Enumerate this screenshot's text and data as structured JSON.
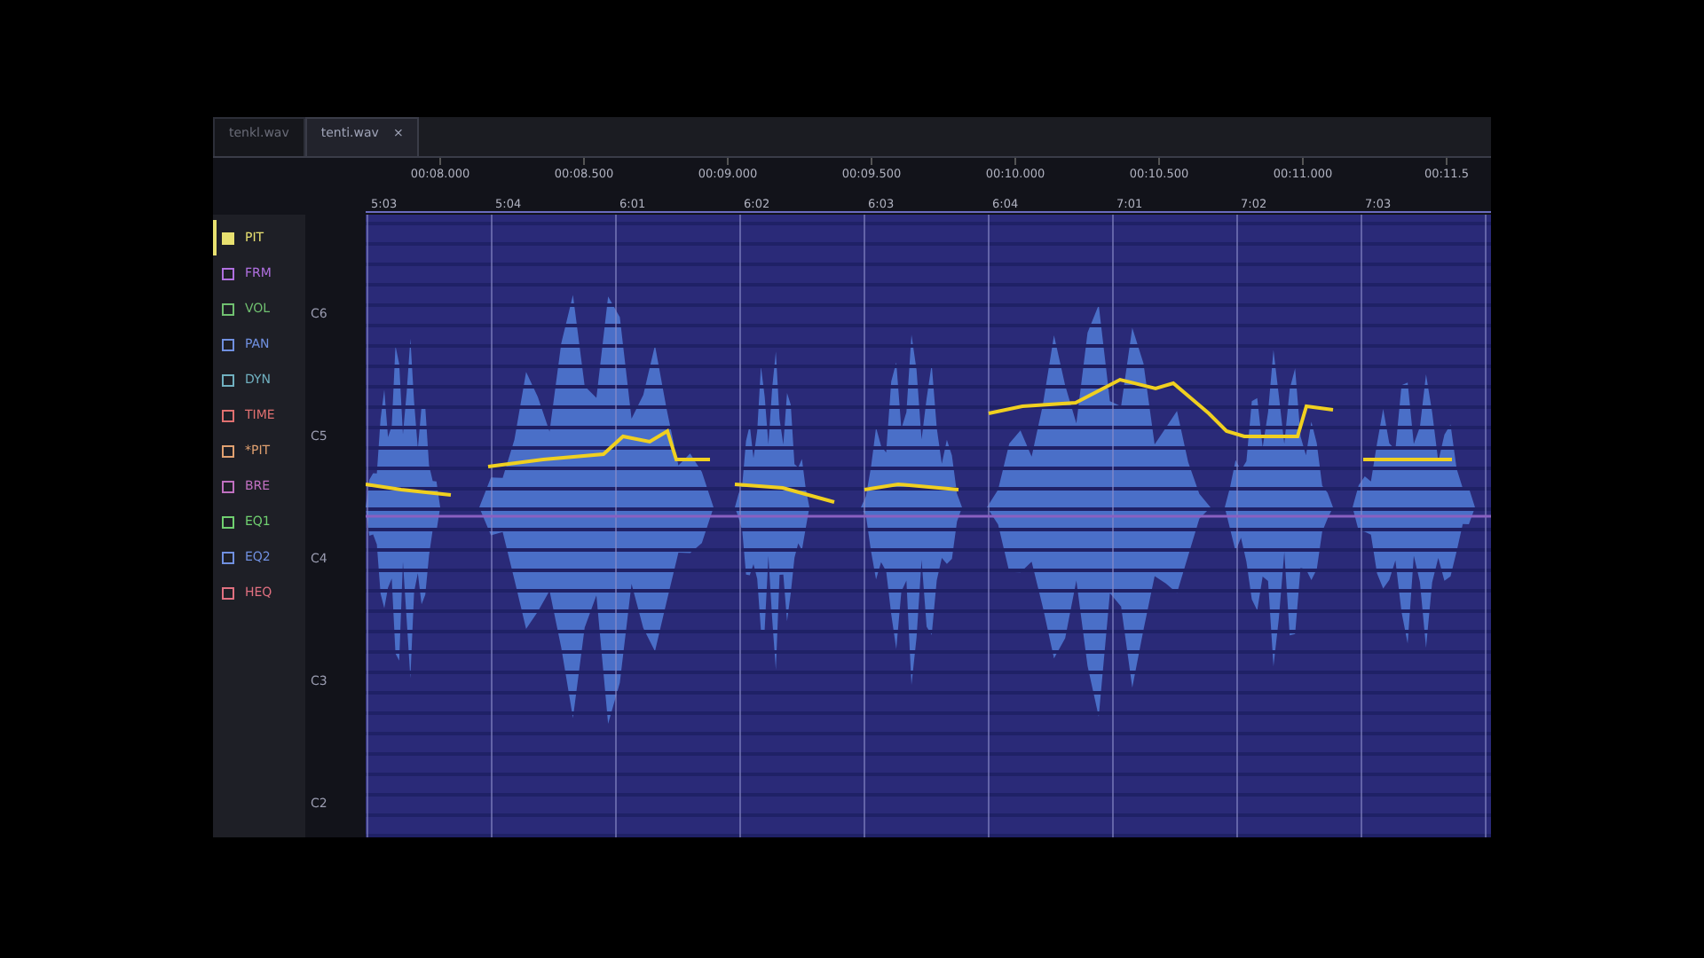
{
  "tabs": [
    {
      "label": "tenkl.wav",
      "selected": false
    },
    {
      "label": "tenti.wav",
      "selected": true,
      "close": "×"
    }
  ],
  "ruler": {
    "times": [
      "00:08.000",
      "00:08.500",
      "00:09.000",
      "00:09.500",
      "00:10.000",
      "00:10.500",
      "00:11.000",
      "00:11.5"
    ],
    "bars": [
      "5:03",
      "5:04",
      "6:01",
      "6:02",
      "6:03",
      "6:04",
      "7:01",
      "7:02",
      "7:03"
    ]
  },
  "parameters": [
    {
      "label": "PIT",
      "checked": true,
      "color": "#e8e070"
    },
    {
      "label": "FRM",
      "checked": false,
      "color": "#b070e0"
    },
    {
      "label": "VOL",
      "checked": false,
      "color": "#70c070"
    },
    {
      "label": "PAN",
      "checked": false,
      "color": "#7090e0"
    },
    {
      "label": "DYN",
      "checked": false,
      "color": "#70b0c0"
    },
    {
      "label": "TIME",
      "checked": false,
      "color": "#e07070"
    },
    {
      "label": "*PIT",
      "checked": false,
      "color": "#e0a070"
    },
    {
      "label": "BRE",
      "checked": false,
      "color": "#c070c0"
    },
    {
      "label": "EQ1",
      "checked": false,
      "color": "#70d070"
    },
    {
      "label": "EQ2",
      "checked": false,
      "color": "#7090e0"
    },
    {
      "label": "HEQ",
      "checked": false,
      "color": "#e07080"
    }
  ],
  "notes": [
    "C6",
    "C5",
    "C4",
    "C3",
    "C2"
  ]
}
